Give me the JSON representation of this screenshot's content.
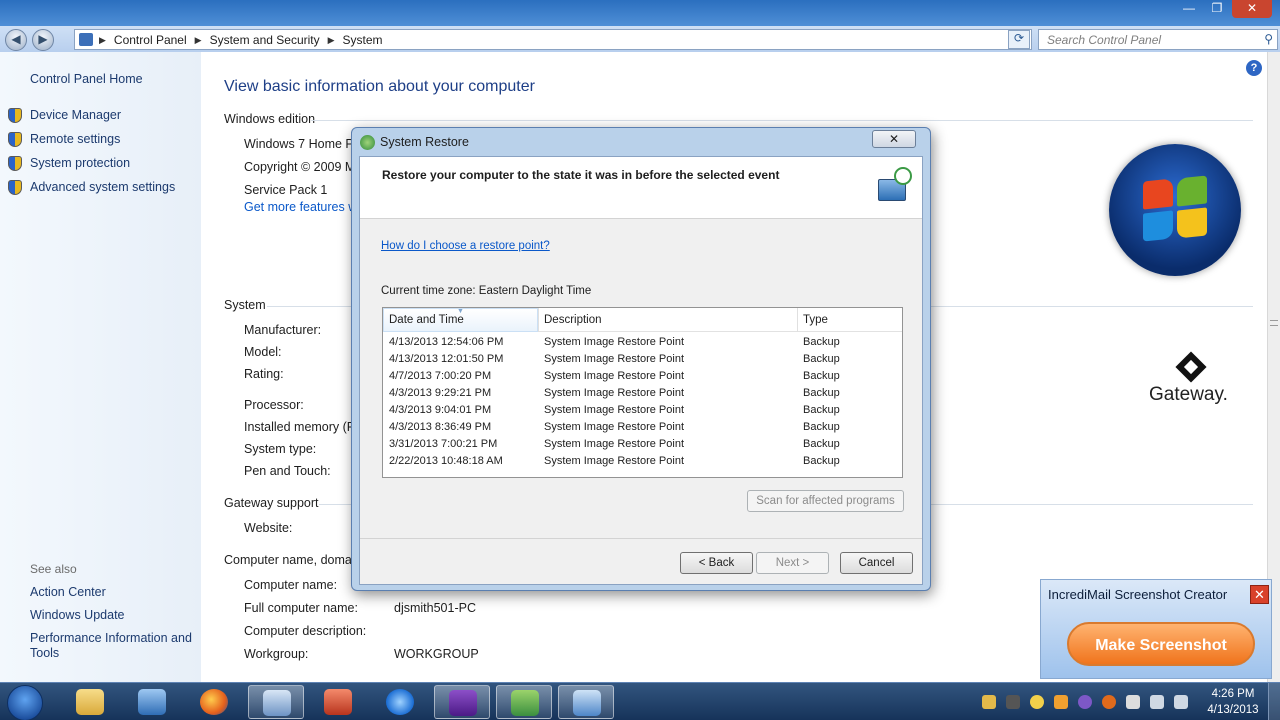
{
  "window": {
    "minimize": "—",
    "maximize": "❐",
    "close": "✕"
  },
  "address": {
    "breadcrumbs": [
      "Control Panel",
      "System and Security",
      "System"
    ],
    "search_placeholder": "Search Control Panel"
  },
  "sidebar": {
    "home": "Control Panel Home",
    "tasks": [
      "Device Manager",
      "Remote settings",
      "System protection",
      "Advanced system settings"
    ],
    "see_also_title": "See also",
    "see_also": [
      "Action Center",
      "Windows Update",
      "Performance Information and",
      "Tools"
    ]
  },
  "main": {
    "heading": "View basic information about your computer",
    "windows_edition": {
      "title": "Windows edition",
      "edition": "Windows 7 Home Pr",
      "copyright": "Copyright © 2009 M",
      "service_pack": "Service Pack 1",
      "more_features": "Get more features w"
    },
    "system": {
      "title": "System",
      "manufacturer_label": "Manufacturer:",
      "model_label": "Model:",
      "rating_label": "Rating:",
      "processor_label": "Processor:",
      "memory_label": "Installed memory (R",
      "type_label": "System type:",
      "pen_label": "Pen and Touch:"
    },
    "support": {
      "title": "Gateway support",
      "website_label": "Website:"
    },
    "computer_name": {
      "title": "Computer name, domai",
      "name_label": "Computer name:",
      "full_name_label": "Full computer name:",
      "full_name_value": "djsmith501-PC",
      "description_label": "Computer description:",
      "workgroup_label": "Workgroup:",
      "workgroup_value": "WORKGROUP"
    },
    "gateway_logo": "Gateway."
  },
  "dialog": {
    "title": "System Restore",
    "close": "✕",
    "header": "Restore your computer to the state it was in before the selected event",
    "help_link": "How do I choose a restore point?",
    "timezone": "Current time zone: Eastern Daylight Time",
    "columns": [
      "Date and Time",
      "Description",
      "Type"
    ],
    "rows": [
      {
        "date": "4/13/2013 12:54:06 PM",
        "desc": "System Image Restore Point",
        "type": "Backup"
      },
      {
        "date": "4/13/2013 12:01:50 PM",
        "desc": "System Image Restore Point",
        "type": "Backup"
      },
      {
        "date": "4/7/2013 7:00:20 PM",
        "desc": "System Image Restore Point",
        "type": "Backup"
      },
      {
        "date": "4/3/2013 9:29:21 PM",
        "desc": "System Image Restore Point",
        "type": "Backup"
      },
      {
        "date": "4/3/2013 9:04:01 PM",
        "desc": "System Image Restore Point",
        "type": "Backup"
      },
      {
        "date": "4/3/2013 8:36:49 PM",
        "desc": "System Image Restore Point",
        "type": "Backup"
      },
      {
        "date": "3/31/2013 7:00:21 PM",
        "desc": "System Image Restore Point",
        "type": "Backup"
      },
      {
        "date": "2/22/2013 10:48:18 AM",
        "desc": "System Image Restore Point",
        "type": "Backup"
      }
    ],
    "scan_button": "Scan for affected programs",
    "back_button": "< Back",
    "next_button": "Next >",
    "cancel_button": "Cancel"
  },
  "incredimail": {
    "title": "IncrediMail Screenshot Creator",
    "close": "✕",
    "button": "Make Screenshot"
  },
  "taskbar": {
    "time": "4:26 PM",
    "date": "4/13/2013"
  }
}
